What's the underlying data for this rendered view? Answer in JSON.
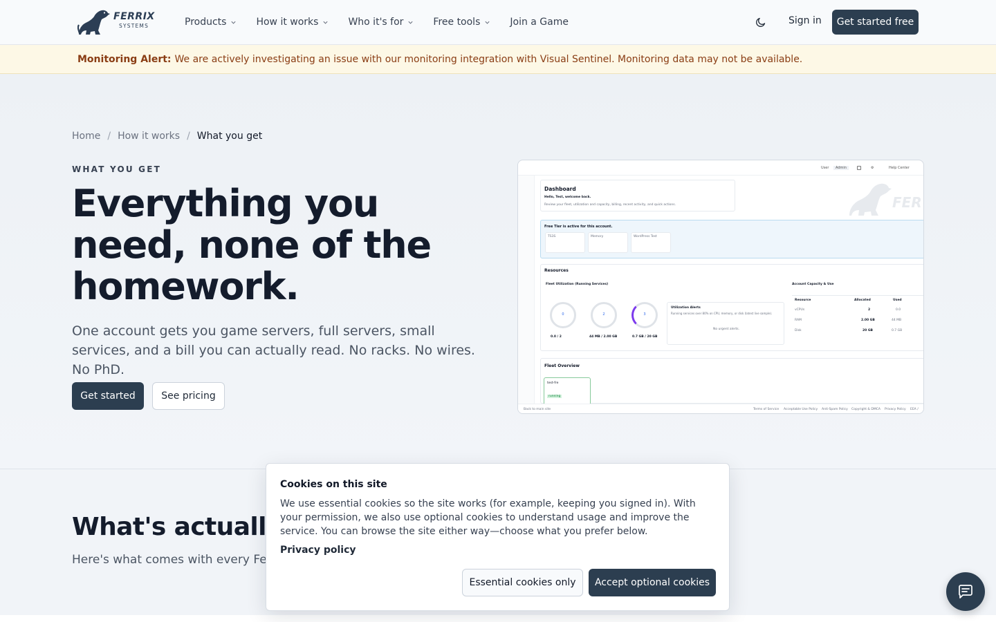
{
  "header": {
    "logo": {
      "name": "FERRIX",
      "sub": "SYSTEMS"
    },
    "nav": [
      {
        "label": "Products",
        "has_dropdown": true
      },
      {
        "label": "How it works",
        "has_dropdown": true
      },
      {
        "label": "Who it's for",
        "has_dropdown": true
      },
      {
        "label": "Free tools",
        "has_dropdown": true
      },
      {
        "label": "Join a Game",
        "has_dropdown": false
      }
    ],
    "theme_icon": "moon-icon",
    "sign_in": "Sign in",
    "cta": "Get started free"
  },
  "alert": {
    "label": "Monitoring Alert:",
    "message": "We are actively investigating an issue with our monitoring integration with Visual Sentinel. Monitoring data may not be available."
  },
  "hero": {
    "breadcrumb": [
      "Home",
      "How it works",
      "What you get"
    ],
    "eyebrow": "WHAT YOU GET",
    "title": "Everything you need, none of the homework.",
    "subtitle": "One account gets you game servers, full servers, small services, and a bill you can actually read. No racks. No wires. No PhD.",
    "primary_button": "Get started",
    "secondary_button": "See pricing"
  },
  "preview": {
    "topbar": [
      "User",
      "Admin",
      "Help Center"
    ],
    "dashboard_title": "Dashboard",
    "greeting": "Hello, Test, welcome back.",
    "greeting_sub": "Review your fleet, utilization and capacity, billing, recent activity, and quick actions.",
    "free_tier": "Free Tier is active for this account.",
    "free_tier_cards": [
      "TS3S",
      "Memory",
      "WordPress Test"
    ],
    "resources_title": "Resources",
    "fleet_util_title": "Fleet Utilization (Running Services)",
    "rings": [
      {
        "label": "CPU",
        "value": "0.0 / 2"
      },
      {
        "label": "Memory",
        "value": "44 MB / 2.00 GB"
      },
      {
        "label": "Disk",
        "value": "0.7 GB / 20 GB"
      }
    ],
    "alerts_title": "Utilization Alerts",
    "alerts_sub": "Running services over 80% on CPU, memory, or disk (latest live sample).",
    "alerts_empty": "No urgent alerts.",
    "capacity_title": "Account Capacity & Use",
    "capacity_headers": [
      "Resource",
      "Allocated",
      "Used"
    ],
    "capacity_rows": [
      [
        "vCPUs",
        "2",
        "0.0"
      ],
      [
        "RAM",
        "2.00 GB",
        "44 MB"
      ],
      [
        "Disk",
        "20 GB",
        "0.7 GB"
      ]
    ],
    "fleet_overview_title": "Fleet Overview",
    "fleet_item": "test-fre",
    "fleet_status": "running",
    "footer_left": "Back to main site",
    "footer_links": [
      "Terms of Service",
      "Acceptable Use Policy",
      "Anti-Spam Policy",
      "Copyright & DMCA",
      "Privacy Policy",
      "EEA /"
    ]
  },
  "section": {
    "title": "What's actually in",
    "subtitle": "Here's what comes with every Ferri"
  },
  "cookie": {
    "title": "Cookies on this site",
    "body": "We use essential cookies so the site works (for example, keeping you signed in). With your permission, we also use optional cookies to understand usage and improve the service. You can browse the site either way—choose what you prefer below.",
    "privacy_link": "Privacy policy",
    "essential_button": "Essential cookies only",
    "accept_button": "Accept optional cookies"
  },
  "chat": {
    "icon": "chat-icon"
  },
  "colors": {
    "brand_dark": "#2c3e50",
    "alert_bg": "#fdf8e6",
    "alert_text": "#8a3d14"
  }
}
